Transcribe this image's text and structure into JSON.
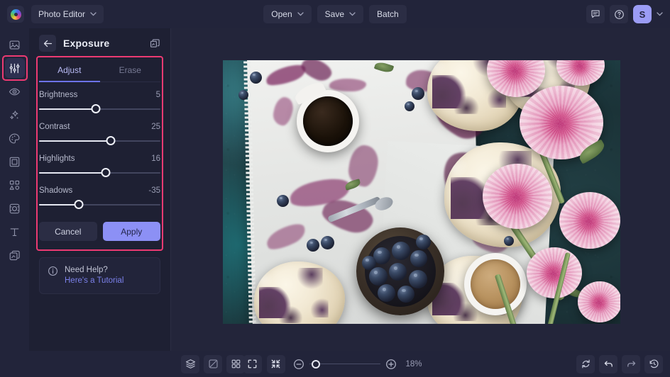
{
  "app": {
    "logo": "brand-color-wheel",
    "workspace_label": "Photo Editor"
  },
  "topbar": {
    "open_label": "Open",
    "save_label": "Save",
    "batch_label": "Batch",
    "feedback_icon": "comment-icon",
    "help_icon": "question-circle-icon",
    "avatar_initial": "S",
    "account_caret": "chevron-down-icon"
  },
  "rail": {
    "items": [
      {
        "name": "image",
        "icon": "image-icon",
        "active": false
      },
      {
        "name": "adjust",
        "icon": "sliders-icon",
        "active": true
      },
      {
        "name": "retouch",
        "icon": "eye-icon",
        "active": false
      },
      {
        "name": "effects",
        "icon": "sparkles-icon",
        "active": false
      },
      {
        "name": "color",
        "icon": "palette-icon",
        "active": false
      },
      {
        "name": "frame",
        "icon": "frame-icon",
        "active": false
      },
      {
        "name": "shapes",
        "icon": "shapes-icon",
        "active": false
      },
      {
        "name": "focus",
        "icon": "focus-icon",
        "active": false
      },
      {
        "name": "text",
        "icon": "text-icon",
        "active": false
      },
      {
        "name": "layers",
        "icon": "layers-copy-icon",
        "active": false
      }
    ]
  },
  "panel": {
    "back_icon": "arrow-left-icon",
    "title": "Exposure",
    "duplicate_icon": "copy-layers-icon",
    "tabs": [
      {
        "label": "Adjust",
        "active": true
      },
      {
        "label": "Erase",
        "active": false
      }
    ],
    "sliders": [
      {
        "label": "Brightness",
        "value": "5",
        "percent": 47,
        "min": -100,
        "max": 100
      },
      {
        "label": "Contrast",
        "value": "25",
        "percent": 59,
        "min": -100,
        "max": 100
      },
      {
        "label": "Highlights",
        "value": "16",
        "percent": 55,
        "min": -100,
        "max": 100
      },
      {
        "label": "Shadows",
        "value": "-35",
        "percent": 33,
        "min": -100,
        "max": 100
      }
    ],
    "cancel_label": "Cancel",
    "apply_label": "Apply",
    "help": {
      "icon": "info-circle-icon",
      "title": "Need Help?",
      "link": "Here's a Tutorial"
    }
  },
  "canvas": {
    "image_alt": "Blueberry crumble scones with coffee cups, bowl of blueberries and pink peonies on a dark slate surface"
  },
  "bottombar": {
    "left_tools": [
      {
        "name": "layers",
        "icon": "layers-icon"
      },
      {
        "name": "compare",
        "icon": "compare-icon"
      },
      {
        "name": "grid",
        "icon": "grid-icon"
      }
    ],
    "fit_icon": "fit-screen-icon",
    "actual_icon": "shrink-icon",
    "zoom_out_icon": "minus-circle-icon",
    "zoom_in_icon": "plus-circle-icon",
    "zoom_level": "18%",
    "zoom_percent": 5,
    "right_tools": [
      {
        "name": "reset",
        "icon": "reset-icon"
      },
      {
        "name": "undo",
        "icon": "undo-icon"
      },
      {
        "name": "redo",
        "icon": "redo-icon"
      },
      {
        "name": "history",
        "icon": "history-icon"
      }
    ]
  },
  "colors": {
    "accent": "#8c90f5",
    "highlight_outline": "#ec3a72",
    "topbar_bg": "#22243a",
    "panel_bg": "#1e2033",
    "canvas_bg": "#23253a"
  }
}
